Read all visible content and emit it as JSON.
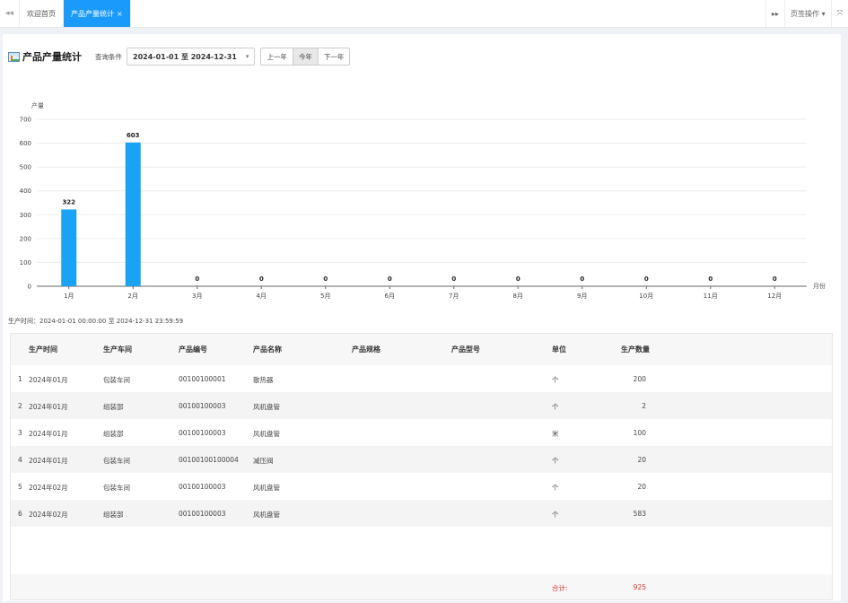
{
  "tabbar": {
    "left_nav": "◂◂",
    "tabs": [
      {
        "label": "欢迎首页",
        "active": false
      },
      {
        "label": "产品产量统计",
        "active": true,
        "close": "×"
      }
    ],
    "right_nav": "▸▸",
    "page_ops": "页签操作 ▾",
    "fullscreen": "⤧"
  },
  "header": {
    "title": "产品产量统计",
    "query_label": "查询条件",
    "date_range": "2024-01-01 至 2024-12-31",
    "caret": "▾",
    "buttons": [
      {
        "label": "上一年",
        "active": false
      },
      {
        "label": "今年",
        "active": true
      },
      {
        "label": "下一年",
        "active": false
      }
    ]
  },
  "chart_data": {
    "type": "bar",
    "ylabel": "产量",
    "xlabel": "月份",
    "ylim": [
      0,
      700
    ],
    "yticks": [
      0,
      100,
      200,
      300,
      400,
      500,
      600,
      700
    ],
    "categories": [
      "1月",
      "2月",
      "3月",
      "4月",
      "5月",
      "6月",
      "7月",
      "8月",
      "9月",
      "10月",
      "11月",
      "12月"
    ],
    "values": [
      322,
      603,
      0,
      0,
      0,
      0,
      0,
      0,
      0,
      0,
      0,
      0
    ],
    "bar_color": "#1aa3f5",
    "grid": true
  },
  "range_text": "生产时间：2024-01-01 00:00:00 至 2024-12-31 23:59:59",
  "table": {
    "columns": [
      "生产时间",
      "生产车间",
      "产品编号",
      "产品名称",
      "产品规格",
      "产品型号",
      "单位",
      "生产数量"
    ],
    "rows": [
      {
        "seq": "1",
        "time": "2024年01月",
        "workshop": "包装车间",
        "code": "00100100001",
        "name": "散热器",
        "spec": "",
        "model": "",
        "unit": "个",
        "qty": "200"
      },
      {
        "seq": "2",
        "time": "2024年01月",
        "workshop": "组装部",
        "code": "00100100003",
        "name": "风机盘管",
        "spec": "",
        "model": "",
        "unit": "个",
        "qty": "2"
      },
      {
        "seq": "3",
        "time": "2024年01月",
        "workshop": "组装部",
        "code": "00100100003",
        "name": "风机盘管",
        "spec": "",
        "model": "",
        "unit": "米",
        "qty": "100"
      },
      {
        "seq": "4",
        "time": "2024年01月",
        "workshop": "包装车间",
        "code": "00100100100004",
        "name": "减压阀",
        "spec": "",
        "model": "",
        "unit": "个",
        "qty": "20"
      },
      {
        "seq": "5",
        "time": "2024年02月",
        "workshop": "包装车间",
        "code": "00100100003",
        "name": "风机盘管",
        "spec": "",
        "model": "",
        "unit": "个",
        "qty": "20"
      },
      {
        "seq": "6",
        "time": "2024年02月",
        "workshop": "组装部",
        "code": "00100100003",
        "name": "风机盘管",
        "spec": "",
        "model": "",
        "unit": "个",
        "qty": "583"
      }
    ],
    "total_label": "合计:",
    "total_value": "925"
  }
}
